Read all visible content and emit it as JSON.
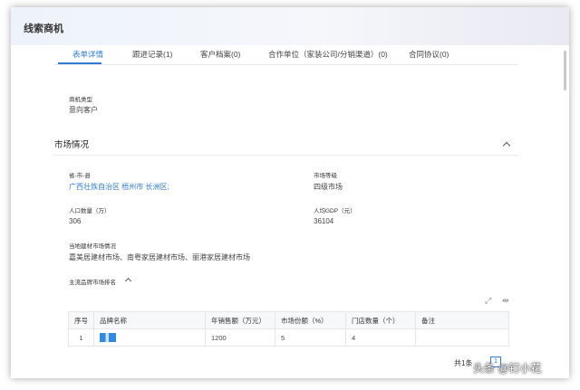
{
  "window": {
    "title": "线索商机"
  },
  "tabs": [
    {
      "label": "表单详情",
      "active": true
    },
    {
      "label": "跟进记录(1)"
    },
    {
      "label": "客户档案(0)"
    },
    {
      "label": "合作单位（家装公司/分销渠道）(0)"
    },
    {
      "label": "合同协议(0)"
    }
  ],
  "basic": {
    "opportunity_type_label": "商机类型",
    "opportunity_type_value": "意向客户"
  },
  "market": {
    "section_title": "市场情况",
    "region_label": "省-市-县",
    "region_value": "广西壮族自治区 梧州市 长洲区;",
    "level_label": "市场等级",
    "level_value": "四级市场",
    "population_label": "人口数量（万）",
    "population_value": "306",
    "gdp_label": "人均GDP（元）",
    "gdp_value": "36104",
    "local_market_label": "当地建材市场情况",
    "local_market_value": "嘉美居建材市场、南粤家居建材市场、丽港家居建材市场",
    "brand_ranking_label": "主流品牌市场排名"
  },
  "table": {
    "headers": [
      "序号",
      "品牌名称",
      "年销售额（万元）",
      "市场份额（%）",
      "门店数量（个）",
      "备注"
    ],
    "rows": [
      {
        "index": "1",
        "brand": "",
        "annual_sales": "1200",
        "market_share": "5",
        "store_count": "4",
        "remark": ""
      }
    ]
  },
  "pagination": {
    "total_text": "共1条",
    "current_page": "1"
  },
  "watermark": {
    "text": "头条 @钉小花"
  },
  "colors": {
    "accent": "#2f7cd9"
  }
}
